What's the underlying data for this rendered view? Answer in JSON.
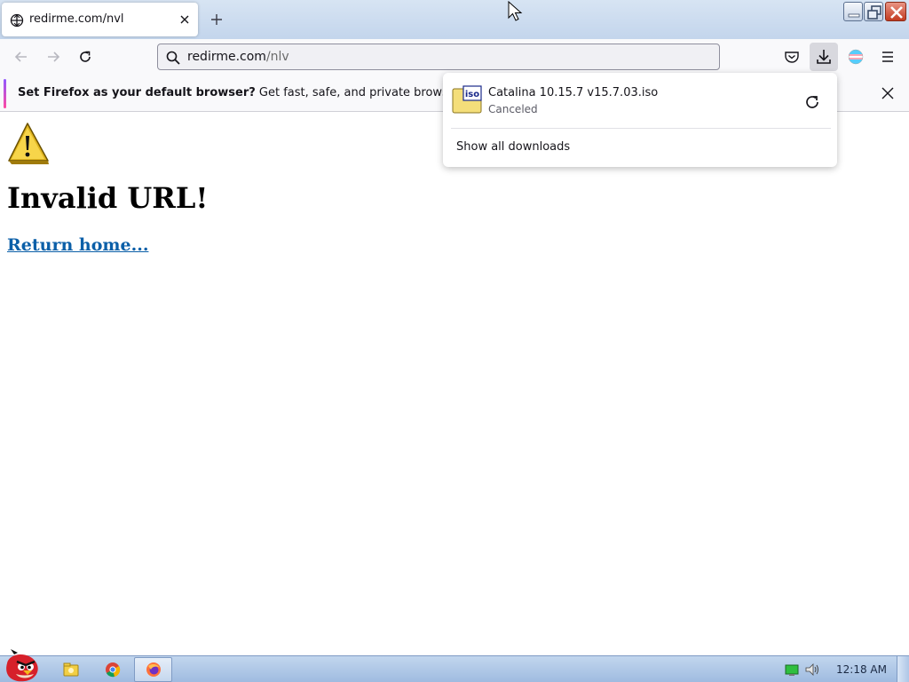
{
  "tab": {
    "title": "redirme.com/nvl"
  },
  "urlbar": {
    "domain": "redirme.com",
    "path": "/nlv"
  },
  "notification": {
    "bold": "Set Firefox as your default browser?",
    "text": " Get fast, safe, and private browsing wheneve"
  },
  "page": {
    "heading": "Invalid URL!",
    "link": "Return home..."
  },
  "downloads": {
    "filename": "Catalina 10.15.7 v15.7.03.iso",
    "status": "Canceled",
    "show_all": "Show all downloads",
    "file_badge": "iso"
  },
  "taskbar": {
    "clock": "12:18 AM"
  },
  "colors": {
    "accent_link": "#0b5fa8",
    "notif_stripe_top": "#9059ff",
    "notif_stripe_bottom": "#ff4aa2"
  }
}
